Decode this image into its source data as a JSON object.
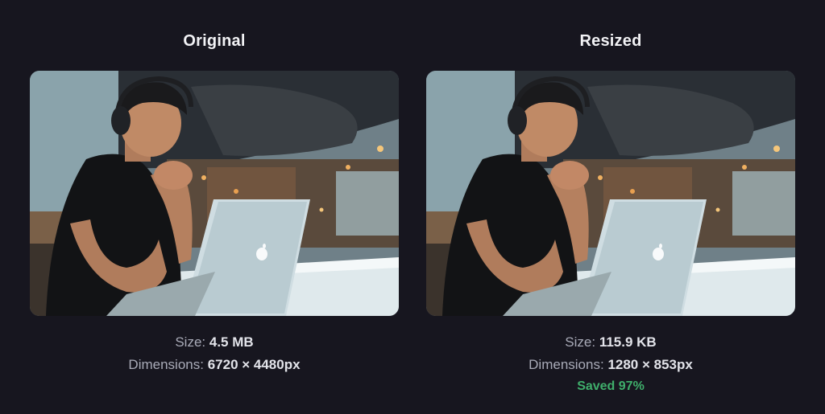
{
  "original": {
    "title": "Original",
    "size_label": "Size:",
    "size_value": "4.5 MB",
    "dimensions_label": "Dimensions:",
    "dimensions_value": "6720 × 4480px"
  },
  "resized": {
    "title": "Resized",
    "size_label": "Size:",
    "size_value": "115.9 KB",
    "dimensions_label": "Dimensions:",
    "dimensions_value": "1280 × 853px",
    "saved_text": "Saved 97%"
  },
  "colors": {
    "background": "#17161f",
    "title": "#f2f2f5",
    "label": "#a9abb8",
    "value": "#e3e4ea",
    "saved": "#3fae6b"
  }
}
